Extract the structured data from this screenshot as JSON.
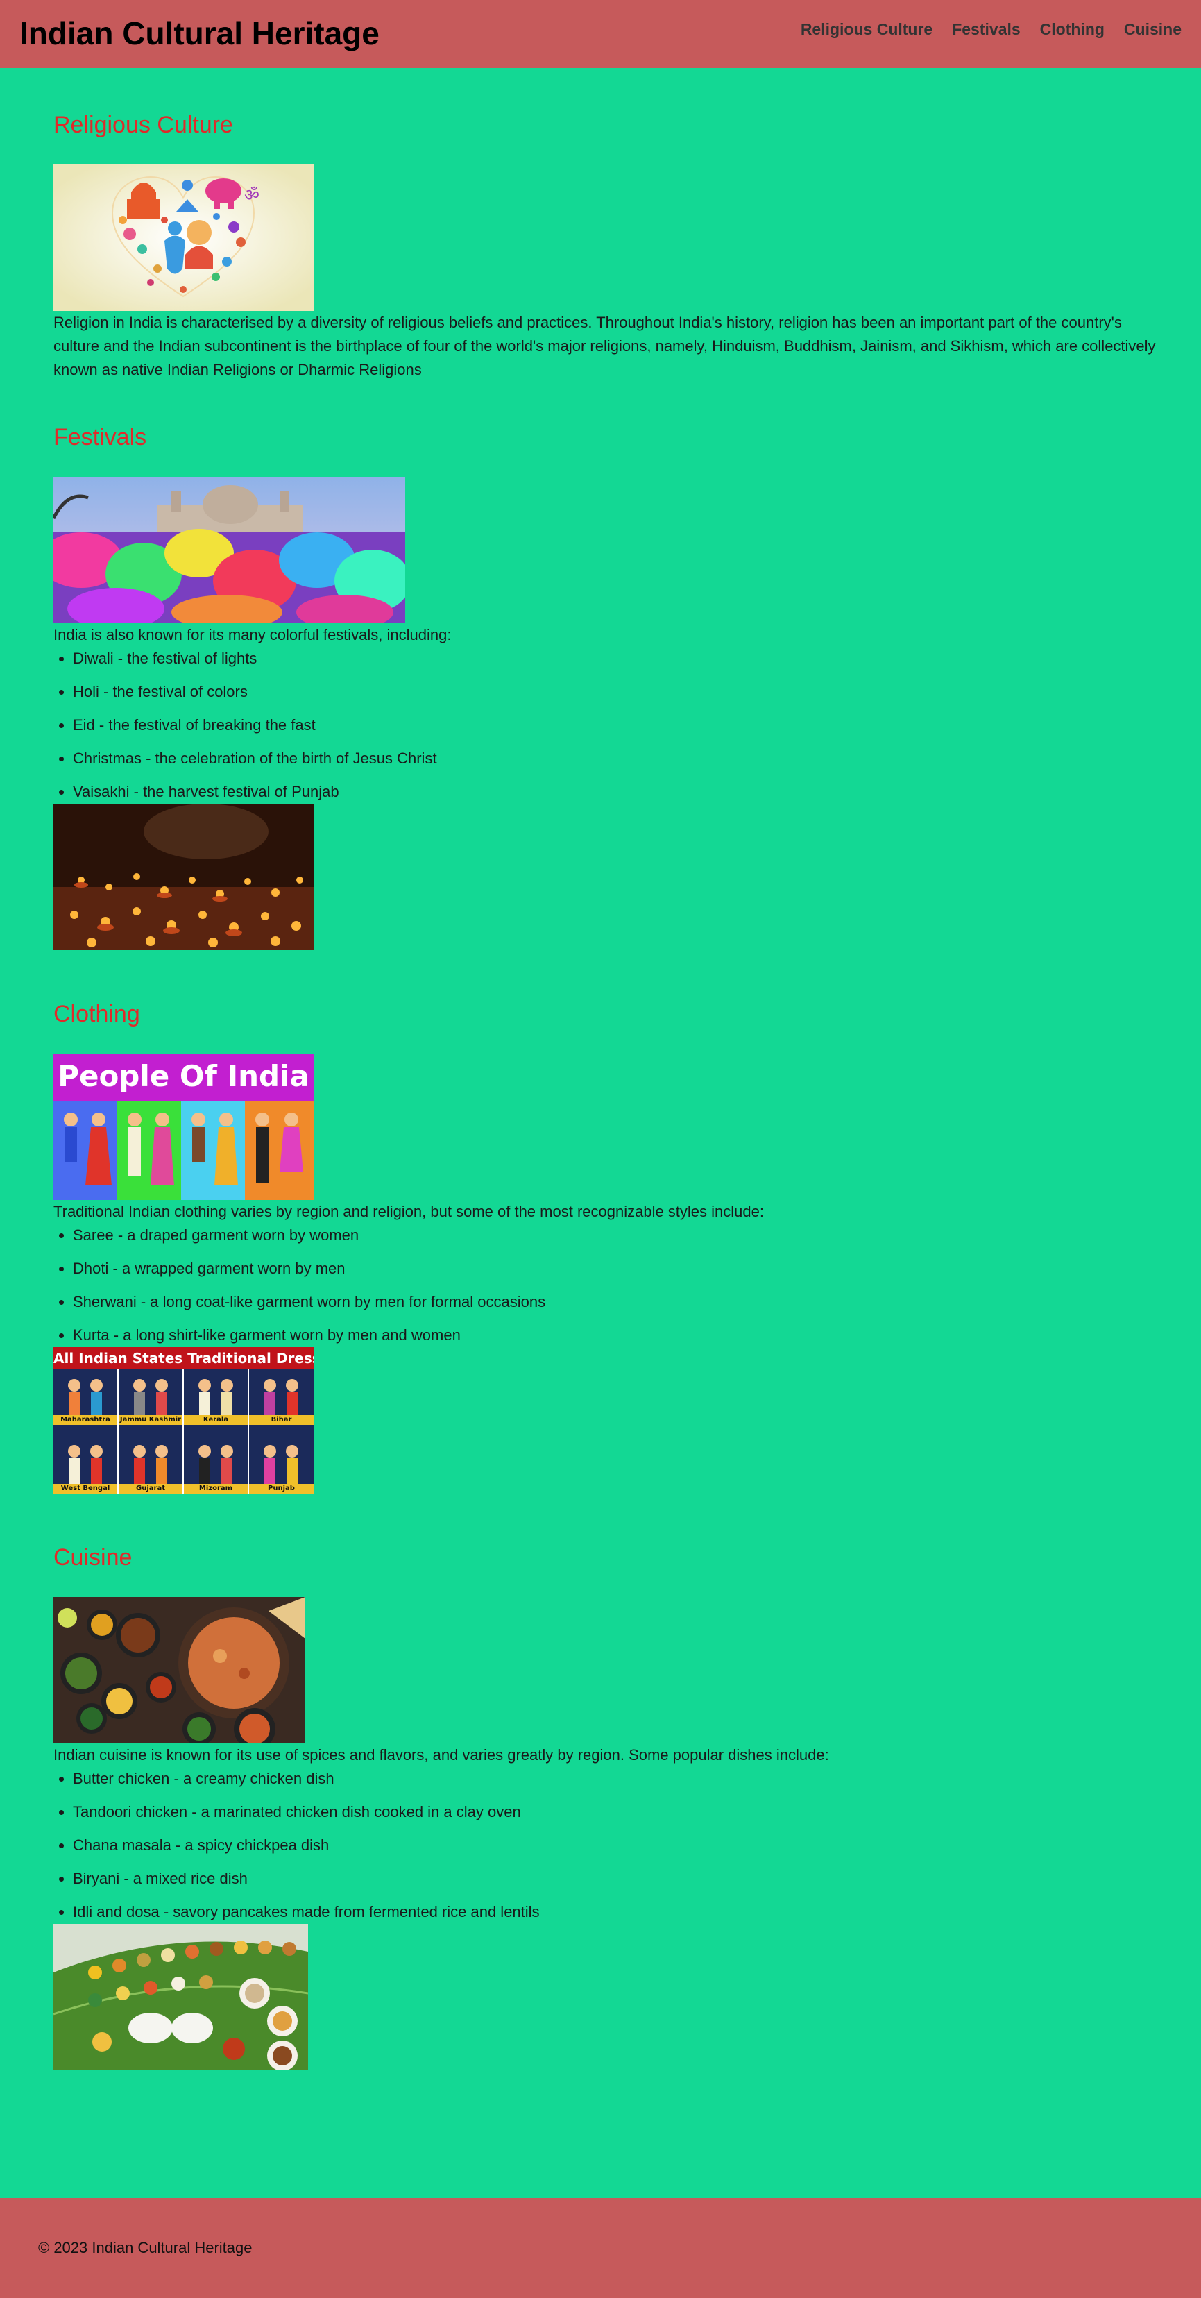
{
  "site": {
    "title": "Indian Cultural Heritage"
  },
  "nav": [
    {
      "label": "Religious Culture"
    },
    {
      "label": "Festivals"
    },
    {
      "label": "Clothing"
    },
    {
      "label": "Cuisine"
    }
  ],
  "sections": {
    "religion": {
      "heading": "Religious Culture",
      "text": "Religion in India is characterised by a diversity of religious beliefs and practices. Throughout India's history, religion has been an important part of the country's culture and the Indian subcontinent is the birthplace of four of the world's major religions, namely, Hinduism, Buddhism, Jainism, and Sikhism, which are collectively known as native Indian Religions or Dharmic Religions"
    },
    "festivals": {
      "heading": "Festivals",
      "intro": "India is also known for its many colorful festivals, including:",
      "items": [
        "Diwali - the festival of lights",
        "Holi - the festival of colors",
        "Eid - the festival of breaking the fast",
        "Christmas - the celebration of the birth of Jesus Christ",
        "Vaisakhi - the harvest festival of Punjab"
      ]
    },
    "clothing": {
      "heading": "Clothing",
      "intro": "Traditional Indian clothing varies by region and religion, but some of the most recognizable styles include:",
      "items": [
        "Saree - a draped garment worn by women",
        "Dhoti - a wrapped garment worn by men",
        "Sherwani - a long coat-like garment worn by men for formal occasions",
        "Kurta - a long shirt-like garment worn by men and women"
      ],
      "poster1_title": "People Of India",
      "poster2_title": "All Indian States Traditional Dresses",
      "poster2_labels": [
        "Maharashtra",
        "Jammu Kashmir",
        "Kerala",
        "Bihar",
        "West Bengal",
        "Gujarat",
        "Mizoram",
        "Punjab"
      ]
    },
    "cuisine": {
      "heading": "Cuisine",
      "intro": "Indian cuisine is known for its use of spices and flavors, and varies greatly by region. Some popular dishes include:",
      "items": [
        "Butter chicken - a creamy chicken dish",
        "Tandoori chicken - a marinated chicken dish cooked in a clay oven",
        "Chana masala - a spicy chickpea dish",
        "Biryani - a mixed rice dish",
        "Idli and dosa - savory pancakes made from fermented rice and lentils"
      ]
    }
  },
  "footer": {
    "text": "© 2023 Indian Cultural Heritage"
  },
  "colors": {
    "background": "#13d894",
    "header": "#c65a5b",
    "heading": "#e02a2a"
  }
}
